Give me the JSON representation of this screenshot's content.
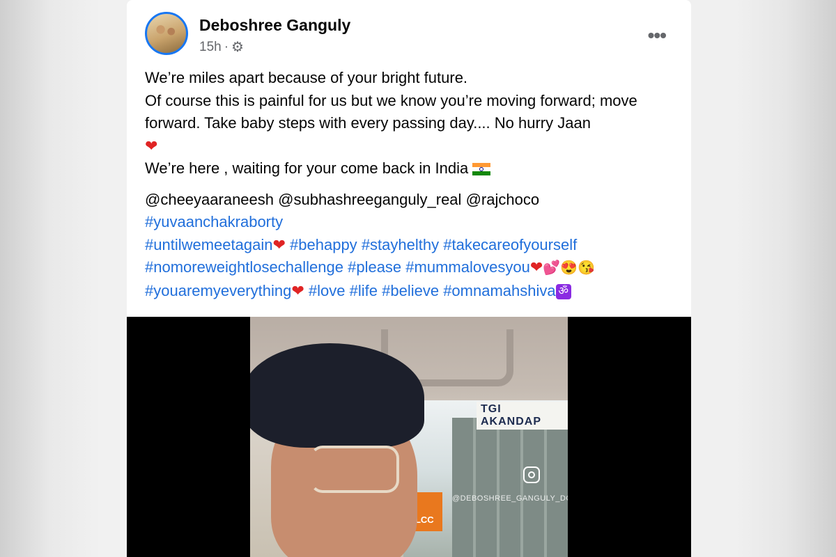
{
  "post": {
    "author": "Deboshree Ganguly",
    "time": "15h",
    "audience_icon": "gear-icon",
    "more_icon": "more-options-icon",
    "more_label": "•••",
    "lines": [
      "We’re miles apart because of your bright future.",
      "Of course this is painful for us but we know you’re moving forward; move forward. Take baby steps with every passing day.... No hurry Jaan",
      "We’re here , waiting for your come back in India"
    ],
    "mentions": [
      "@cheeyaaraneesh",
      "@subhashreeganguly_real",
      "@rajchoco"
    ],
    "hashtags": [
      "#yuvaanchakraborty",
      "#untilwemeetagain",
      "#behappy",
      "#stayhelthy",
      "#takecareofyourself",
      "#nomoreweightlosechallenge",
      "#please",
      "#mummalovesyou",
      "#youaremyeverything",
      "#love",
      "#life",
      "#believe",
      "#omnamahshiva"
    ],
    "emojis": {
      "heart": "❤",
      "small_hearts": "💕",
      "heart_eyes": "😍",
      "kiss_face": "😘",
      "om": "ॐ"
    }
  },
  "media": {
    "sign_text": "TGI AKANDAP",
    "store_text": "VLCC",
    "watermark": "@DEBOSHREE_GANGULY_DG"
  },
  "colors": {
    "link": "#216fdb",
    "avatar_ring": "#1877f2",
    "secondary_text": "#65676b"
  }
}
